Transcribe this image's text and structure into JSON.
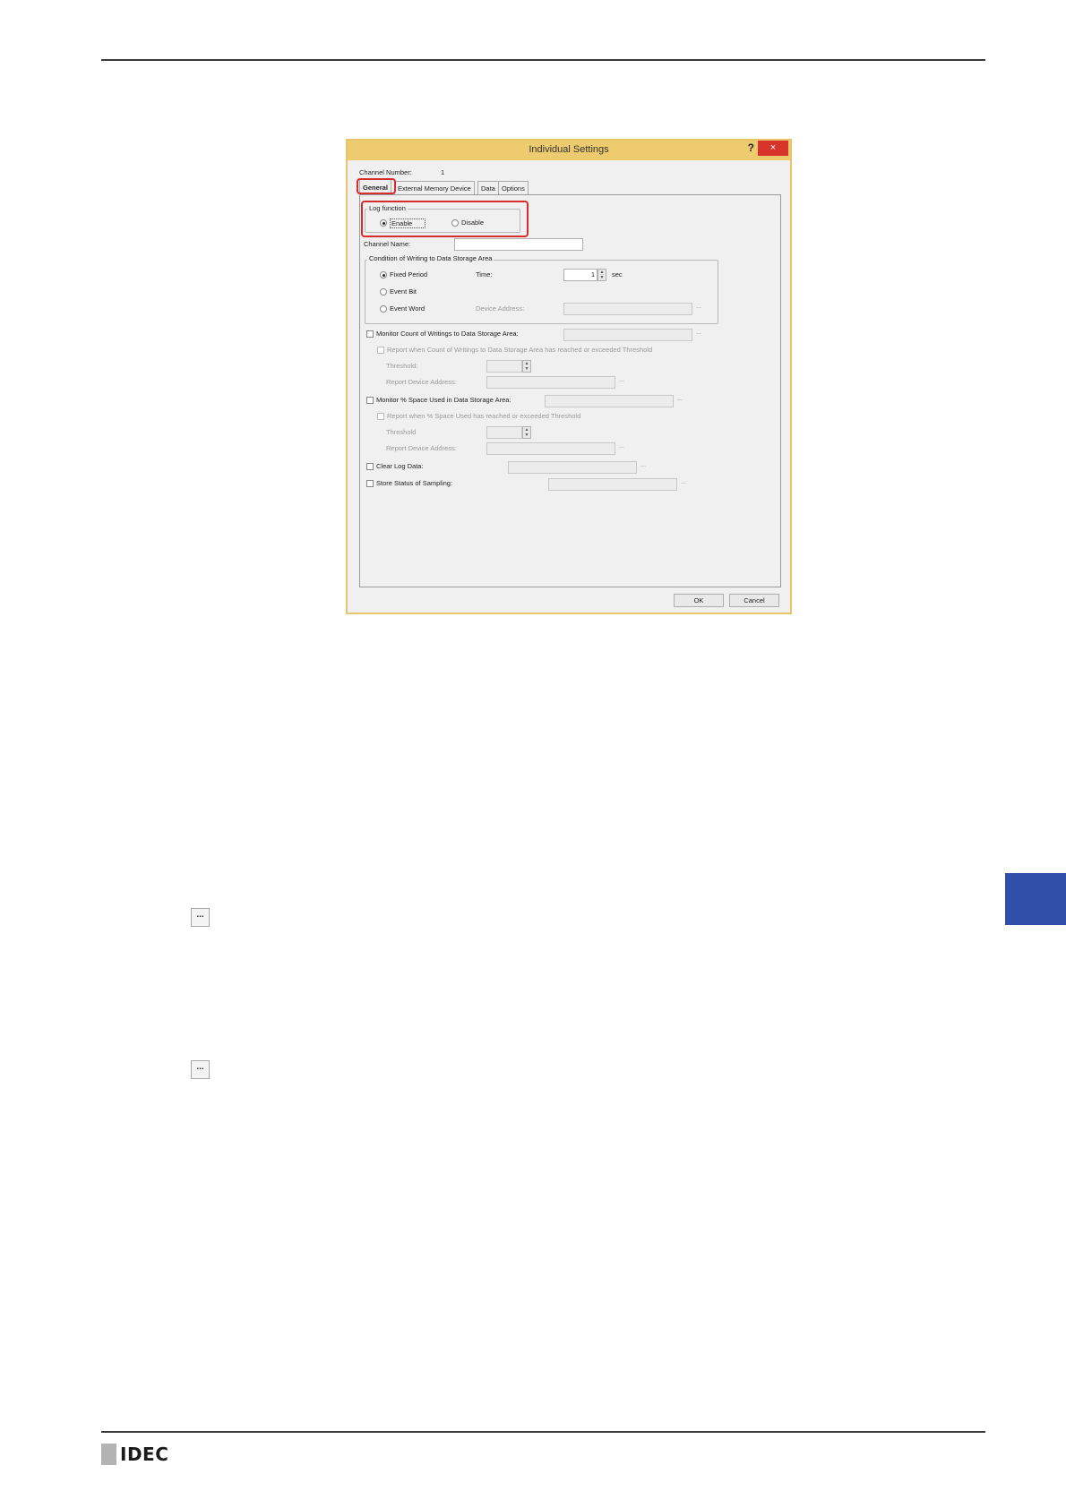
{
  "dialog": {
    "title": "Individual Settings",
    "help_glyph": "?",
    "close_glyph": "×",
    "channel_number_label": "Channel Number:",
    "channel_number_value": "1",
    "tabs": [
      {
        "label": "General"
      },
      {
        "label": "External Memory Device"
      },
      {
        "label": "Data"
      },
      {
        "label": "Options"
      }
    ],
    "log_function": {
      "label": "Log function",
      "enable_label": "Enable",
      "disable_label": "Disable",
      "selected": "Enable"
    },
    "channel_name_label": "Channel Name:",
    "condition": {
      "label": "Condition of Writing to Data Storage Area",
      "fixed_period_label": "Fixed Period",
      "time_label": "Time:",
      "time_value": "1",
      "time_unit": "sec",
      "event_bit_label": "Event Bit",
      "event_word_label": "Event Word",
      "device_address_label": "Device Address:",
      "selected": "Fixed Period"
    },
    "monitor_count": {
      "label": "Monitor Count of Writings to Data Storage Area:",
      "report_label": "Report when Count of Writings to Data Storage Area has reached or exceeded Threshold",
      "threshold_label": "Threshold:",
      "report_device_label": "Report Device Address:"
    },
    "monitor_space": {
      "label": "Monitor % Space Used in Data Storage Area:",
      "report_label": "Report when % Space Used has reached or exceeded Threshold",
      "threshold_label": "Threshold",
      "report_device_label": "Report Device Address:"
    },
    "clear_log_label": "Clear Log Data:",
    "store_status_label": "Store Status of Sampling:",
    "ok_label": "OK",
    "cancel_label": "Cancel",
    "browse_glyph": "..."
  },
  "page": {
    "browse_icon_glyph": "...",
    "logo_text": "IDEC"
  }
}
